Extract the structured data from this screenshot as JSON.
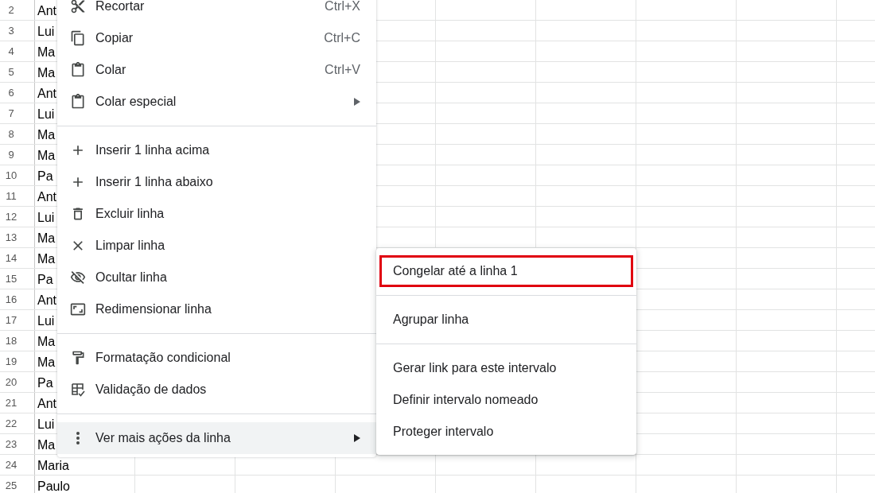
{
  "sheet": {
    "rows": [
      {
        "number": "2",
        "cells": [
          "Ant"
        ]
      },
      {
        "number": "3",
        "cells": [
          "Lui"
        ]
      },
      {
        "number": "4",
        "cells": [
          "Ma"
        ]
      },
      {
        "number": "5",
        "cells": [
          "Ma"
        ]
      },
      {
        "number": "6",
        "cells": [
          "Ant"
        ]
      },
      {
        "number": "7",
        "cells": [
          "Lui"
        ]
      },
      {
        "number": "8",
        "cells": [
          "Ma"
        ]
      },
      {
        "number": "9",
        "cells": [
          "Ma"
        ]
      },
      {
        "number": "10",
        "cells": [
          "Pa"
        ]
      },
      {
        "number": "11",
        "cells": [
          "Ant"
        ]
      },
      {
        "number": "12",
        "cells": [
          "Lui"
        ]
      },
      {
        "number": "13",
        "cells": [
          "Ma"
        ]
      },
      {
        "number": "14",
        "cells": [
          "Ma"
        ]
      },
      {
        "number": "15",
        "cells": [
          "Pa"
        ]
      },
      {
        "number": "16",
        "cells": [
          "Ant"
        ]
      },
      {
        "number": "17",
        "cells": [
          "Lui"
        ]
      },
      {
        "number": "18",
        "cells": [
          "Ma"
        ]
      },
      {
        "number": "19",
        "cells": [
          "Ma"
        ]
      },
      {
        "number": "20",
        "cells": [
          "Pa"
        ]
      },
      {
        "number": "21",
        "cells": [
          "Ant"
        ]
      },
      {
        "number": "22",
        "cells": [
          "Lui"
        ]
      },
      {
        "number": "23",
        "cells": [
          "Ma"
        ]
      },
      {
        "number": "24",
        "cells": [
          "Maria"
        ]
      },
      {
        "number": "25",
        "cells": [
          "Paulo"
        ]
      }
    ]
  },
  "menu": {
    "sections": [
      {
        "items": [
          {
            "label": "Recortar",
            "shortcut": "Ctrl+X",
            "has_submenu": false,
            "selected": false
          },
          {
            "label": "Copiar",
            "shortcut": "Ctrl+C",
            "has_submenu": false,
            "selected": false
          },
          {
            "label": "Colar",
            "shortcut": "Ctrl+V",
            "has_submenu": false,
            "selected": false
          },
          {
            "label": "Colar especial",
            "has_submenu": true,
            "selected": false
          }
        ]
      },
      {
        "items": [
          {
            "label": "Inserir 1 linha acima",
            "has_submenu": false,
            "selected": false
          },
          {
            "label": "Inserir 1 linha abaixo",
            "has_submenu": false,
            "selected": false
          },
          {
            "label": "Excluir linha",
            "has_submenu": false,
            "selected": false
          },
          {
            "label": "Limpar linha",
            "has_submenu": false,
            "selected": false
          },
          {
            "label": "Ocultar linha",
            "has_submenu": false,
            "selected": false
          },
          {
            "label": "Redimensionar linha",
            "has_submenu": false,
            "selected": false
          }
        ]
      },
      {
        "items": [
          {
            "label": "Formatação condicional",
            "has_submenu": false,
            "selected": false
          },
          {
            "label": "Validação de dados",
            "has_submenu": false,
            "selected": false
          }
        ]
      },
      {
        "items": [
          {
            "label": "Ver mais ações da linha",
            "has_submenu": true,
            "selected": true
          }
        ]
      }
    ]
  },
  "submenu": {
    "sections": [
      {
        "items": [
          {
            "label": "Congelar até a linha 1",
            "highlighted": true
          }
        ]
      },
      {
        "items": [
          {
            "label": "Agrupar linha",
            "highlighted": false
          }
        ]
      },
      {
        "items": [
          {
            "label": "Gerar link para este intervalo",
            "highlighted": false
          },
          {
            "label": "Definir intervalo nomeado",
            "highlighted": false
          },
          {
            "label": "Proteger intervalo",
            "highlighted": false
          }
        ]
      }
    ]
  }
}
